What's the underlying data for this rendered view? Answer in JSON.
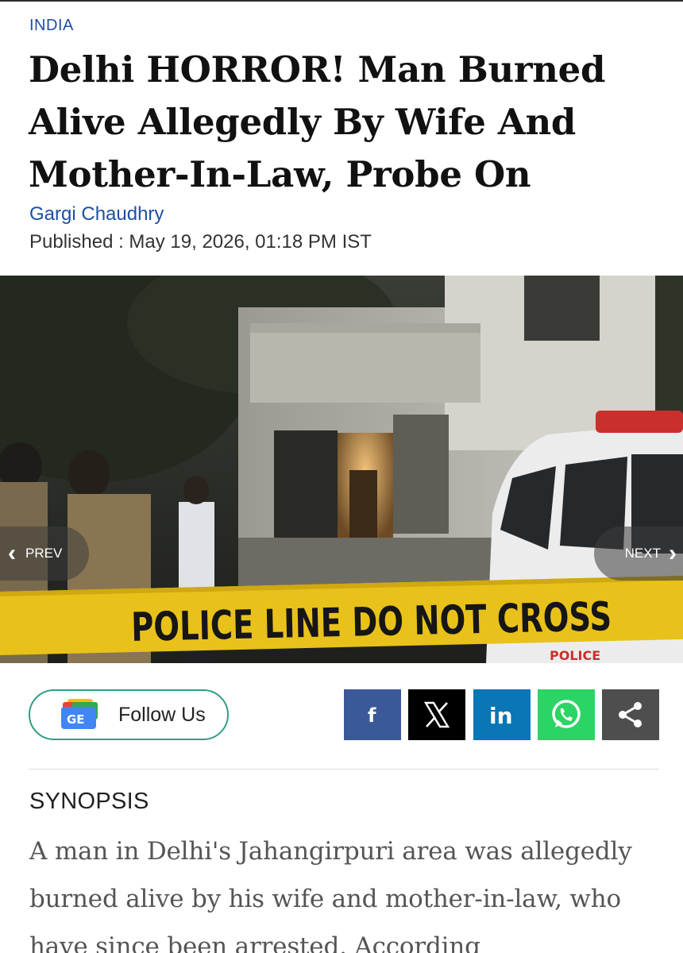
{
  "article": {
    "category": "INDIA",
    "headline": "Delhi HORROR! Man Burned Alive Allegedly By Wife And Mother-In-Law, Probe On",
    "author": "Gargi Chaudhry",
    "published": "Published : May 19, 2026, 01:18 PM IST"
  },
  "hero": {
    "tape_text": "POLICE LINE DO NOT CROSS",
    "vehicle_text": "POLICE",
    "prev_label": "PREV",
    "next_label": "NEXT"
  },
  "social": {
    "follow_icon_text": "GE",
    "follow_label": "Follow Us",
    "facebook_label": "f",
    "linkedin_label": "in",
    "icons": [
      "google-news-icon",
      "facebook-icon",
      "x-icon",
      "linkedin-icon",
      "whatsapp-icon",
      "share-icon"
    ],
    "colors": {
      "facebook": "#3b5998",
      "x": "#000000",
      "linkedin": "#0a76b5",
      "whatsapp": "#2bd465",
      "share": "#4e4e4e",
      "follow_border": "#2f9e87"
    }
  },
  "synopsis": {
    "title": "SYNOPSIS",
    "body": "A man in Delhi's Jahangirpuri area was allegedly burned alive by his wife and mother-in-law, who have since been arrested. According"
  },
  "colors": {
    "link": "#1d4fa3",
    "tape": "#e8c21a"
  }
}
